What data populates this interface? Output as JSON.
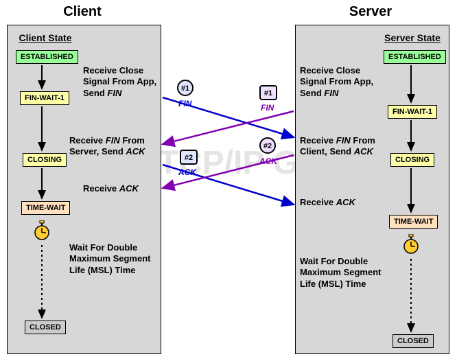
{
  "headings": {
    "client": "Client",
    "server": "Server"
  },
  "labels": {
    "client_state": "Client State",
    "server_state": "Server State"
  },
  "states": {
    "established": "ESTABLISHED",
    "finwait1": "FIN-WAIT-1",
    "closing": "CLOSING",
    "timewait": "TIME-WAIT",
    "closed": "CLOSED"
  },
  "client_events": {
    "e1a": "Receive Close",
    "e1b": "Signal From App,",
    "e1c_prefix": "Send ",
    "e1c_seg": "FIN",
    "e2a_prefix": "Receive ",
    "e2a_seg": "FIN",
    "e2a_suffix": " From",
    "e2b_prefix": "Server, Send ",
    "e2b_seg": "ACK",
    "e3_prefix": "Receive ",
    "e3_seg": "ACK",
    "e4a": "Wait For Double",
    "e4b": "Maximum Segment",
    "e4c": "Life (MSL) Time"
  },
  "server_events": {
    "e1a": "Receive Close",
    "e1b": "Signal From App,",
    "e1c_prefix": "Send ",
    "e1c_seg": "FIN",
    "e2a_prefix": "Receive ",
    "e2a_seg": "FIN",
    "e2a_suffix": " From",
    "e2b_prefix": "Client, Send ",
    "e2b_seg": "ACK",
    "e3_prefix": "Receive ",
    "e3_seg": "ACK",
    "e4a": "Wait For Double",
    "e4b": "Maximum Segment",
    "e4c": "Life (MSL) Time"
  },
  "messages": {
    "client_fin_num": "#1",
    "client_fin_lbl": "FIN",
    "server_fin_num": "#1",
    "server_fin_lbl": "FIN",
    "client_ack_num": "#2",
    "client_ack_lbl": "ACK",
    "server_ack_num": "#2",
    "server_ack_lbl": "ACK"
  },
  "watermark": "The TCP/IP Guide",
  "colors": {
    "blue": "#0000cc",
    "purple": "#8000b0"
  }
}
